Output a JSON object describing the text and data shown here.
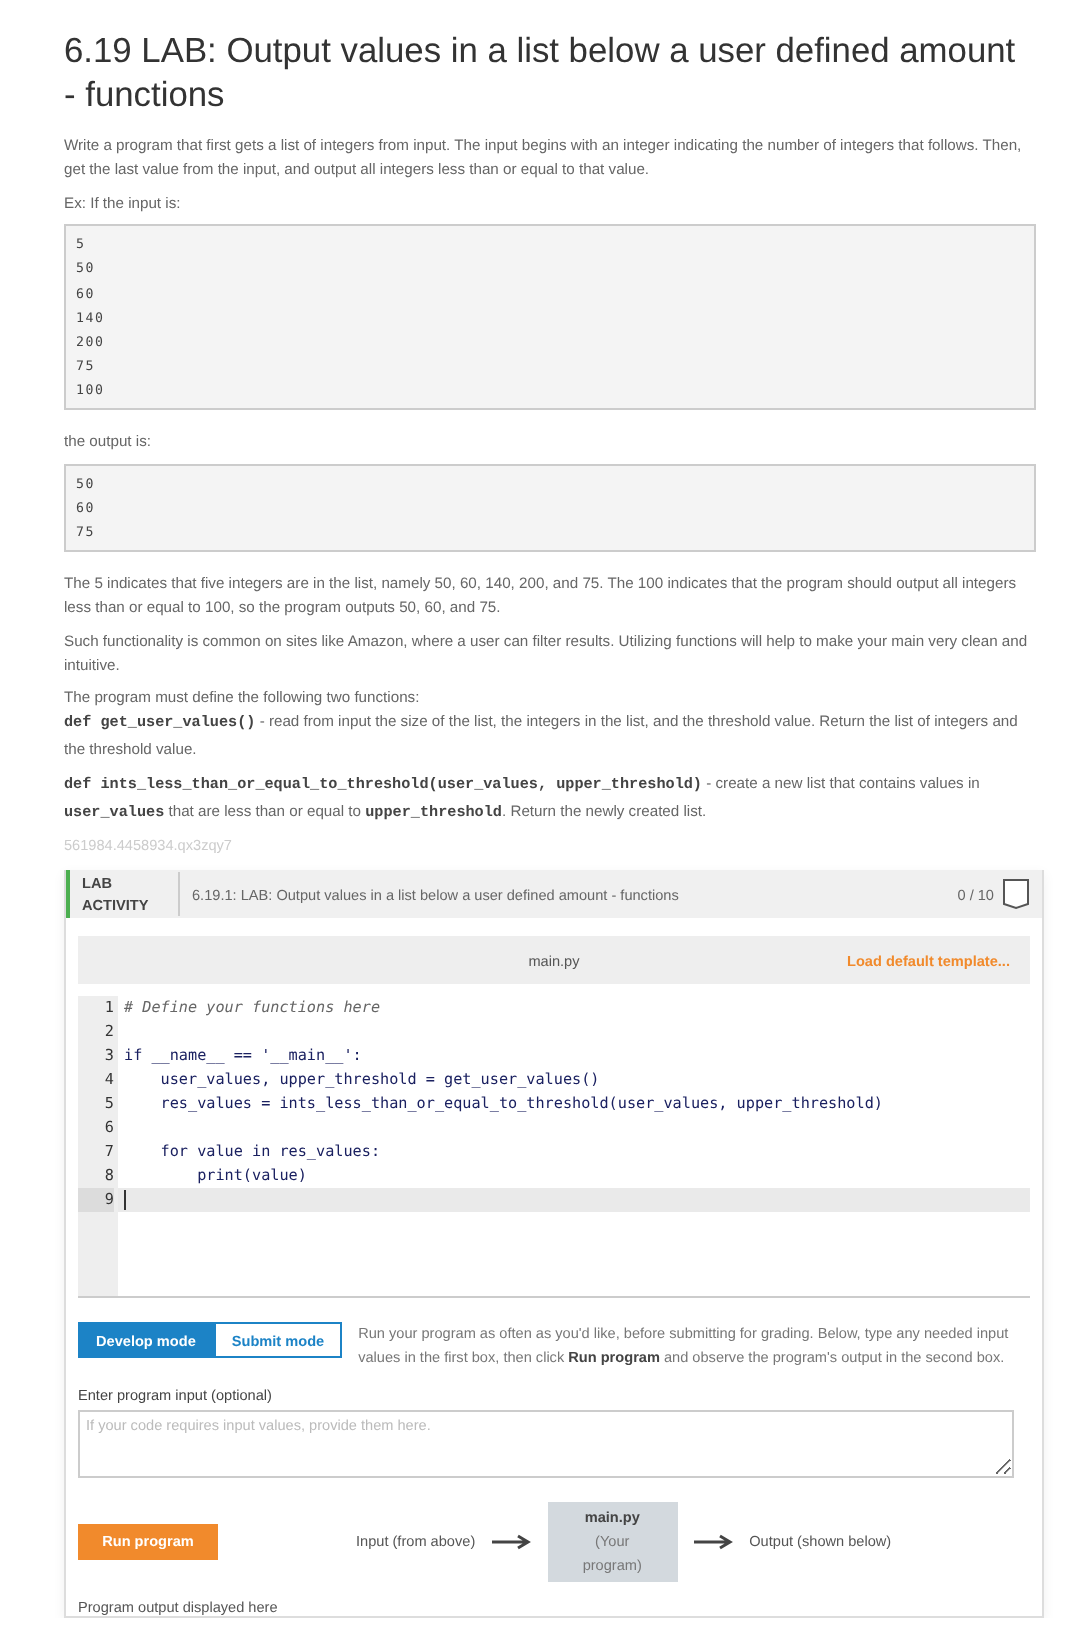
{
  "title": "6.19 LAB: Output values in a list below a user defined amount - functions",
  "intro": [
    "Write a program that first gets a list of integers from input. The input begins with an integer indicating the number of integers that follows. Then, get the last value from the input, and output all integers less than or equal to that value.",
    "Ex: If the input is:"
  ],
  "example_input": [
    "5",
    "50",
    "60",
    "140",
    "200",
    "75",
    "100"
  ],
  "output_label": "the output is:",
  "example_output": [
    "50",
    "60",
    "75"
  ],
  "details": [
    [
      {
        "kind": "text",
        "text": "The 5 indicates that five integers are in the list, namely 50, 60, 140, 200, and 75. The 100 indicates that the program should output all integers less than or equal to 100, so the program outputs 50, 60, and 75."
      }
    ],
    [
      {
        "kind": "text",
        "text": "Such functionality is common on sites like Amazon, where a user can filter results. Utilizing functions will help to make your main very clean and intuitive."
      }
    ],
    [
      {
        "kind": "text",
        "text": "The program must define the following two functions:"
      },
      {
        "kind": "break"
      },
      {
        "kind": "code",
        "text": "def get_user_values()"
      },
      {
        "kind": "text",
        "text": " - read from input the size of the list, the integers in the list, and the threshold value. Return the list of integers and the threshold value."
      }
    ],
    [
      {
        "kind": "code",
        "text": "def ints_less_than_or_equal_to_threshold(user_values, upper_threshold)"
      },
      {
        "kind": "text",
        "text": " - create a new list that contains values in "
      },
      {
        "kind": "code",
        "text": "user_values"
      },
      {
        "kind": "text",
        "text": " that are less than or equal to "
      },
      {
        "kind": "code",
        "text": "upper_threshold"
      },
      {
        "kind": "text",
        "text": ". Return the newly created list."
      }
    ]
  ],
  "reference_id": "561984.4458934.qx3zqy7",
  "lab": {
    "label": "LAB ACTIVITY",
    "title": "6.19.1: LAB: Output values in a list below a user defined amount - functions",
    "score": "0 / 10",
    "file_name": "main.py",
    "template_link": "Load default template...",
    "code": [
      {
        "number": "1",
        "kind": "comment",
        "text": "# Define your functions here",
        "current": false
      },
      {
        "number": "2",
        "kind": "blank",
        "current": false
      },
      {
        "number": "3",
        "kind": "code",
        "text": "if __name__ == '__main__':",
        "current": false
      },
      {
        "number": "4",
        "kind": "code",
        "text": "    user_values, upper_threshold = get_user_values()",
        "current": false
      },
      {
        "number": "5",
        "kind": "code",
        "text": "    res_values = ints_less_than_or_equal_to_threshold(user_values, upper_threshold)",
        "current": false
      },
      {
        "number": "6",
        "kind": "blank",
        "current": false
      },
      {
        "number": "7",
        "kind": "code",
        "text": "    for value in res_values:",
        "current": false
      },
      {
        "number": "8",
        "kind": "code",
        "text": "        print(value)",
        "current": false
      },
      {
        "number": "9",
        "kind": "blank",
        "current": true
      }
    ],
    "modes": [
      {
        "label": "Develop mode",
        "selected": true
      },
      {
        "label": "Submit mode",
        "selected": false
      }
    ],
    "mode_help": "Run your program as often as you'd like, before submitting for grading. Below, type any needed input values in the first box, then click **Run program** and observe the program's output in the second box.",
    "input_label": "Enter program input (optional)",
    "input_placeholder": "If your code requires input values, provide them here.",
    "run_button": "Run program",
    "flow": {
      "input": "Input (from above)",
      "program_name": "main.py",
      "program_note": "(Your program)",
      "output": "Output (shown below)"
    },
    "output_area_label": "Program output displayed here"
  }
}
